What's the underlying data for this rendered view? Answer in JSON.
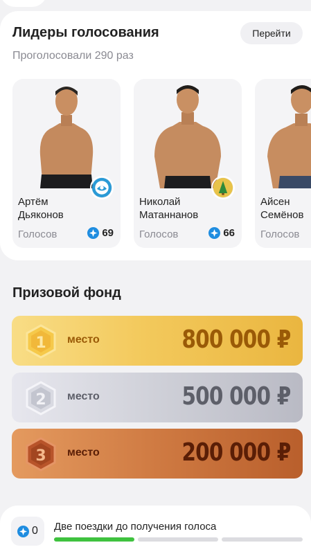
{
  "leaders": {
    "title": "Лидеры голосования",
    "subtitle": "Проголосовали 290 раз",
    "goto_label": "Перейти",
    "fighters": [
      {
        "first_name": "Артём",
        "last_name": "Дьяконов",
        "votes_label": "Голосов",
        "votes": "69"
      },
      {
        "first_name": "Николай",
        "last_name": "Матаннанов",
        "votes_label": "Голосов",
        "votes": "66"
      },
      {
        "first_name": "Айсен",
        "last_name": "Семёнов",
        "votes_label": "Голосов",
        "votes": ""
      }
    ]
  },
  "prize": {
    "title": "Призовой фонд",
    "places": [
      {
        "rank": "1",
        "label": "место",
        "amount": "800 000 ₽"
      },
      {
        "rank": "2",
        "label": "место",
        "amount": "500 000 ₽"
      },
      {
        "rank": "3",
        "label": "место",
        "amount": "200 000 ₽"
      }
    ]
  },
  "rides": {
    "count": "0",
    "text": "Две поездки до получения голоса",
    "progress_steps_total": 3,
    "progress_steps_done": 1
  },
  "colors": {
    "accent_blue": "#1f8de0",
    "progress_done": "#3fc23f",
    "progress_todo": "#dcdce0"
  }
}
